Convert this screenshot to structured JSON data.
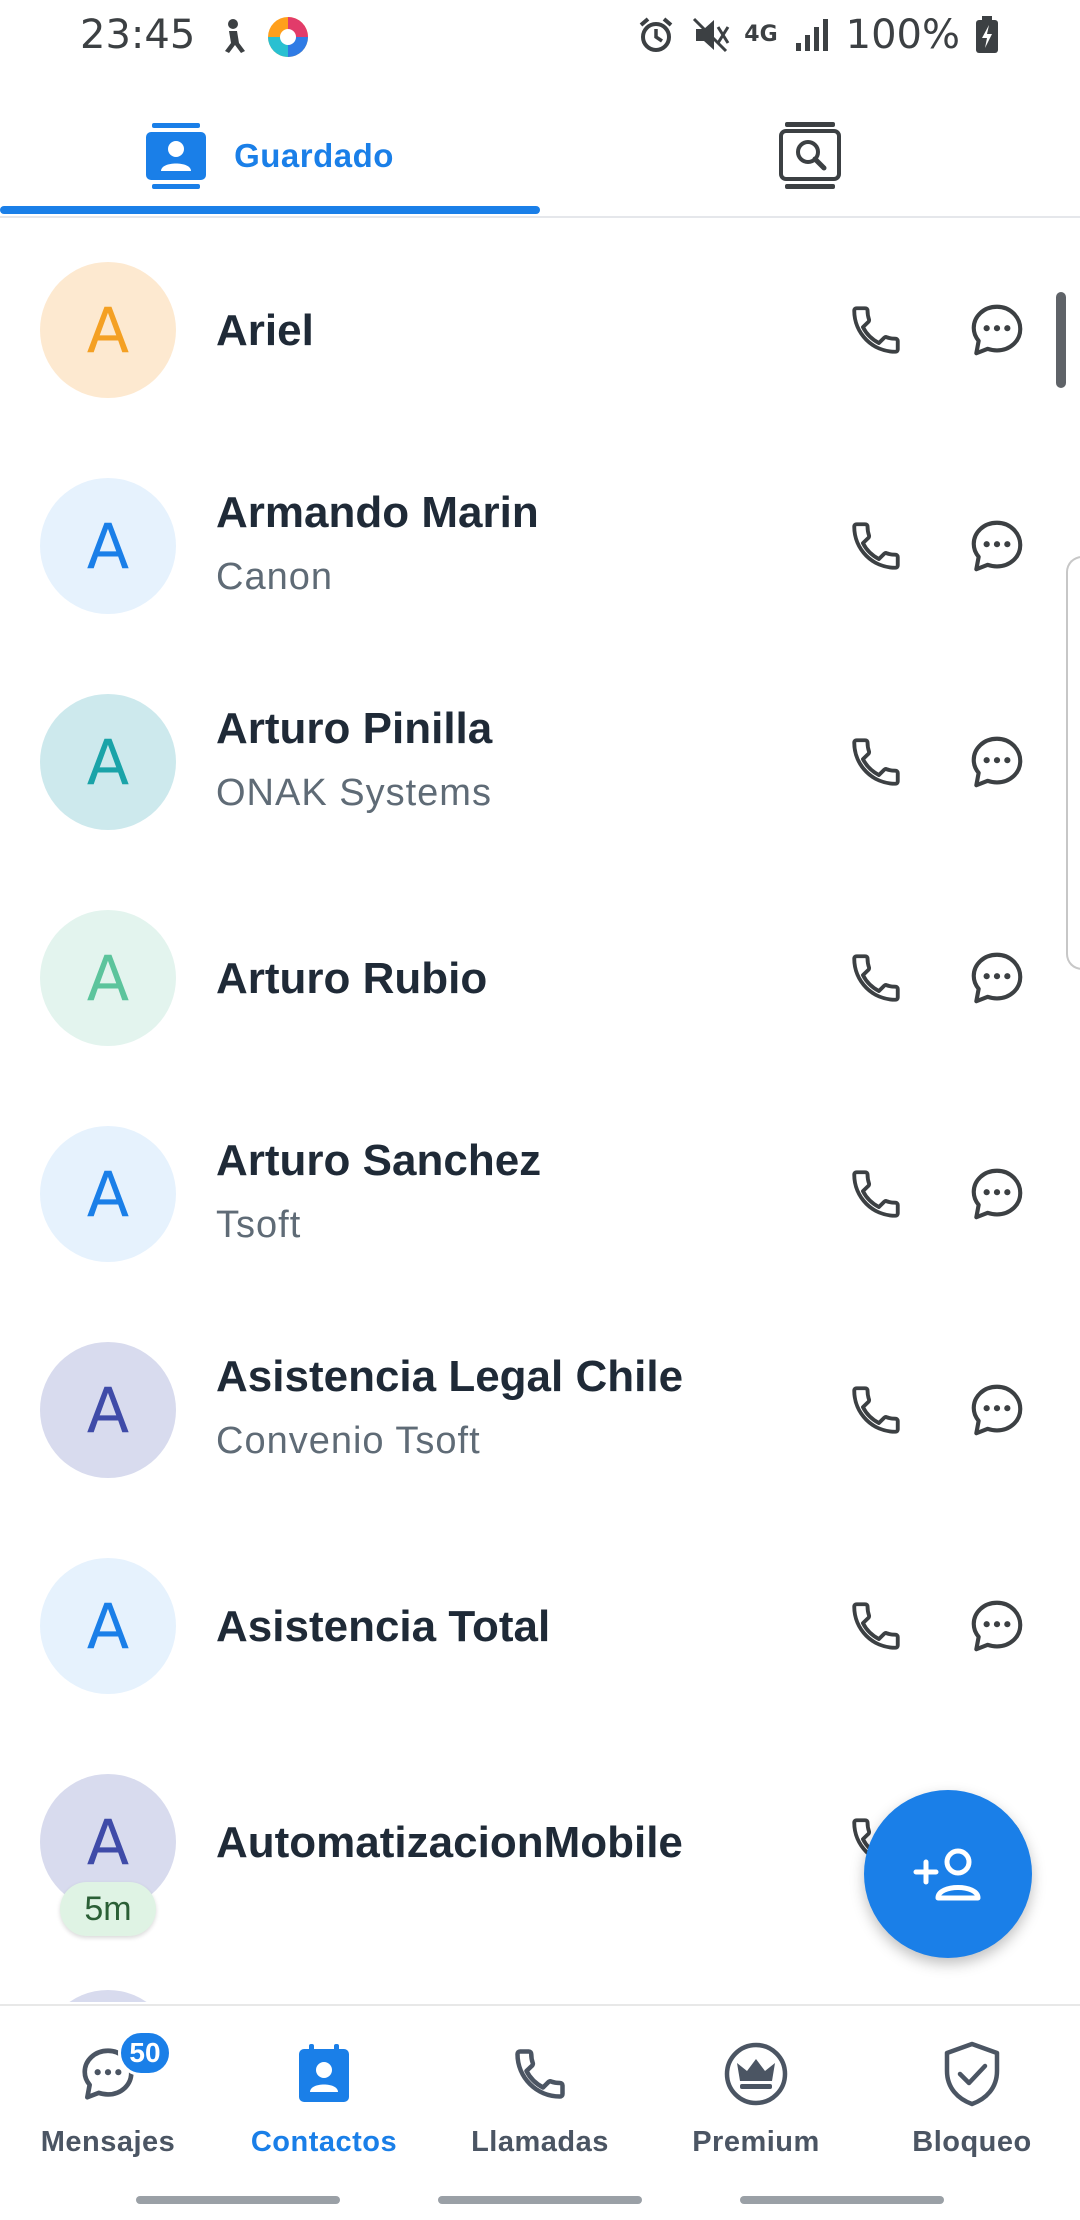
{
  "status_bar": {
    "time": "23:45",
    "network": "4G",
    "battery": "100%"
  },
  "tabs": {
    "saved_label": "Guardado",
    "active": "saved"
  },
  "contacts": [
    {
      "initial": "A",
      "name": "Ariel",
      "subtitle": "",
      "avatar_bg": "#fde9d0",
      "avatar_fg": "#f4a023"
    },
    {
      "initial": "A",
      "name": "Armando Marin",
      "subtitle": "Canon",
      "avatar_bg": "#e6f2fd",
      "avatar_fg": "#1a7fe8"
    },
    {
      "initial": "A",
      "name": "Arturo Pinilla",
      "subtitle": "ONAK Systems",
      "avatar_bg": "#cde9ed",
      "avatar_fg": "#1aa3a8"
    },
    {
      "initial": "A",
      "name": "Arturo Rubio",
      "subtitle": "",
      "avatar_bg": "#e3f4ee",
      "avatar_fg": "#5cc49c"
    },
    {
      "initial": "A",
      "name": "Arturo Sanchez",
      "subtitle": "Tsoft",
      "avatar_bg": "#e6f2fd",
      "avatar_fg": "#1a7fe8"
    },
    {
      "initial": "A",
      "name": "Asistencia Legal Chile",
      "subtitle": "Convenio Tsoft",
      "avatar_bg": "#d8dbee",
      "avatar_fg": "#3f4ba8"
    },
    {
      "initial": "A",
      "name": "Asistencia Total",
      "subtitle": "",
      "avatar_bg": "#e6f2fd",
      "avatar_fg": "#1a7fe8"
    },
    {
      "initial": "A",
      "name": "AutomatizacionMobile",
      "subtitle": "",
      "avatar_bg": "#d8dbee",
      "avatar_fg": "#3f4ba8",
      "badge": "5m"
    }
  ],
  "bottom_nav": {
    "items": [
      {
        "label": "Mensajes",
        "badge": "50"
      },
      {
        "label": "Contactos"
      },
      {
        "label": "Llamadas"
      },
      {
        "label": "Premium"
      },
      {
        "label": "Bloqueo"
      }
    ],
    "active_index": 1
  },
  "colors": {
    "accent": "#1a7fe8",
    "icon": "#3c4043"
  },
  "icons": {
    "fab": "add-contact-icon",
    "row_call": "phone-icon",
    "row_message": "chat-bubble-icon"
  }
}
